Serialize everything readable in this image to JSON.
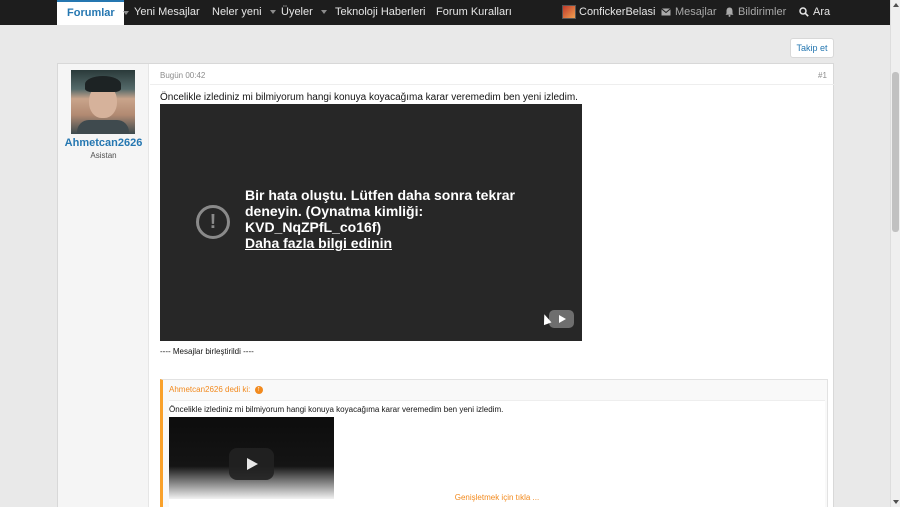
{
  "nav": {
    "forums": "Forumlar",
    "new_posts": "Yeni Mesajlar",
    "whats_new": "Neler yeni",
    "members": "Üyeler",
    "tech_news": "Teknoloji Haberleri",
    "forum_rules": "Forum Kuralları",
    "account_name": "ConfickerBelasi",
    "messages": "Mesajlar",
    "alerts": "Bildirimler",
    "search": "Ara",
    "icons": {
      "messages": "envelope-icon",
      "alerts": "bell-icon",
      "search": "search-icon"
    }
  },
  "follow_label": "Takip et",
  "post": {
    "username": "Ahmetcan2626",
    "user_title": "Asistan",
    "date": "Bugün 00:42",
    "number": "#1",
    "text": "Öncelikle izlediniz mi bilmiyorum hangi konuya koyacağıma karar veremedim ben yeni izledim.",
    "video_error": {
      "message": "Bir hata oluştu. Lütfen daha sonra tekrar deneyin. (Oynatma kimliği: KVD_NqZPfL_co16f)",
      "link": "Daha fazla bilgi edinin"
    },
    "merged_note": "---- Mesajlar birleştirildi ----",
    "quote": {
      "header": "Ahmetcan2626 dedi ki:",
      "text": "Öncelikle izlediniz mi bilmiyorum hangi konuya koyacağıma karar veremedim ben yeni izledim.",
      "expand": "Genişletmek için tıkla ..."
    }
  },
  "colors": {
    "nav_bg": "#1d1d1d",
    "accent": "#2577b1",
    "quote_accent": "#f28a1e",
    "video_bg": "#272727"
  }
}
